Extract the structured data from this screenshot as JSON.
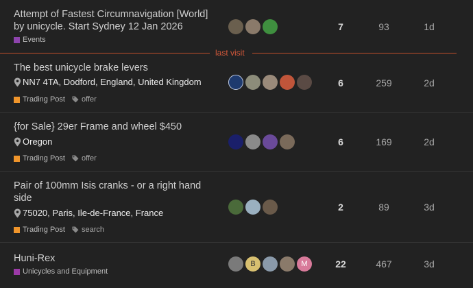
{
  "last_visit_label": "last visit",
  "topics": [
    {
      "title": "Attempt of Fastest Circumnavigation [World] by unicycle. Start Sydney 12 Jan 2026",
      "location": "",
      "category": "Events",
      "category_color": "#8e44ad",
      "tag": "",
      "avatars": [
        {
          "color": "#6a5f4e",
          "letter": ""
        },
        {
          "color": "#8a7a6a",
          "letter": ""
        },
        {
          "color": "#3f8f3f",
          "letter": ""
        }
      ],
      "replies": "7",
      "views": "93",
      "activity": "1d"
    },
    {
      "title": "The best unicycle brake levers",
      "location": "NN7 4TA, Dodford, England, United Kingdom",
      "category": "Trading Post",
      "category_color": "#f0952b",
      "tag": "offer",
      "avatars": [
        {
          "color": "#1e3a6e",
          "letter": ""
        },
        {
          "color": "#8c8c7a",
          "letter": ""
        },
        {
          "color": "#9a8a7a",
          "letter": ""
        },
        {
          "color": "#c0553a",
          "letter": ""
        },
        {
          "color": "#5a4a44",
          "letter": ""
        }
      ],
      "replies": "6",
      "views": "259",
      "activity": "2d"
    },
    {
      "title": "{for Sale} 29er Frame and wheel $450",
      "location": "Oregon",
      "category": "Trading Post",
      "category_color": "#f0952b",
      "tag": "offer",
      "avatars": [
        {
          "color": "#1a1f6a",
          "letter": ""
        },
        {
          "color": "#8a8a8a",
          "letter": ""
        },
        {
          "color": "#6a4a9a",
          "letter": ""
        },
        {
          "color": "#7a6a5a",
          "letter": ""
        }
      ],
      "replies": "6",
      "views": "169",
      "activity": "2d"
    },
    {
      "title": "Pair of 100mm Isis cranks - or a right hand side",
      "location": "75020, Paris, Ile-de-France, France",
      "category": "Trading Post",
      "category_color": "#f0952b",
      "tag": "search",
      "avatars": [
        {
          "color": "#4a6a3a",
          "letter": ""
        },
        {
          "color": "#9ab0c0",
          "letter": ""
        },
        {
          "color": "#6a5a4a",
          "letter": ""
        }
      ],
      "replies": "2",
      "views": "89",
      "activity": "3d"
    },
    {
      "title": "Huni-Rex",
      "location": "",
      "category": "Unicycles and Equipment",
      "category_color": "#9c3aa8",
      "tag": "",
      "avatars": [
        {
          "color": "#7a7a7a",
          "letter": ""
        },
        {
          "color": "#d8c070",
          "letter": "B"
        },
        {
          "color": "#8a9aaa",
          "letter": ""
        },
        {
          "color": "#8a7a6a",
          "letter": ""
        },
        {
          "color": "#d87a9a",
          "letter": "M"
        }
      ],
      "replies": "22",
      "views": "467",
      "activity": "3d"
    }
  ]
}
